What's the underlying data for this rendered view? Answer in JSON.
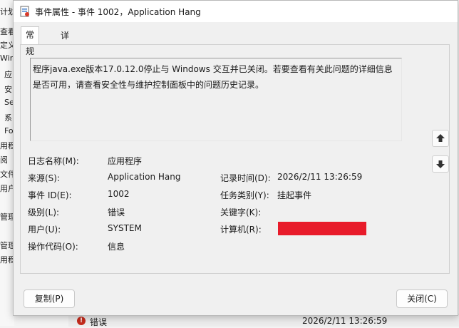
{
  "background": {
    "left_fragments": [
      "计划",
      "查看",
      "定义",
      "Windo",
      "应",
      "安",
      "Se",
      "系",
      "Fo",
      "用程",
      "阅",
      "文件",
      "用户",
      "管理",
      "管理",
      "用程"
    ],
    "bottom_row": {
      "level": "错误",
      "time": "2026/2/11 13:26:59"
    }
  },
  "dialog": {
    "title": "事件属性 - 事件 1002，Application Hang",
    "tabs": [
      "常规",
      "详细信息"
    ],
    "description": "程序java.exe版本17.0.12.0停止与 Windows 交互并已关闭。若要查看有关此问题的详细信息是否可用，请查看安全性与维护控制面板中的问题历史记录。",
    "fields": {
      "log_name_label": "日志名称(M):",
      "log_name": "应用程序",
      "source_label": "来源(S):",
      "source": "Application Hang",
      "logged_label": "记录时间(D):",
      "logged": "2026/2/11 13:26:59",
      "event_id_label": "事件 ID(E):",
      "event_id": "1002",
      "task_label": "任务类别(Y):",
      "task": "挂起事件",
      "level_label": "级别(L):",
      "level": "错误",
      "keywords_label": "关键字(K):",
      "keywords": "",
      "user_label": "用户(U):",
      "user": "SYSTEM",
      "computer_label": "计算机(R):",
      "computer": "",
      "opcode_label": "操作代码(O):",
      "opcode": "信息"
    },
    "buttons": {
      "copy": "复制(P)",
      "close": "关闭(C)"
    },
    "redaction_color": "#e81b2a"
  }
}
